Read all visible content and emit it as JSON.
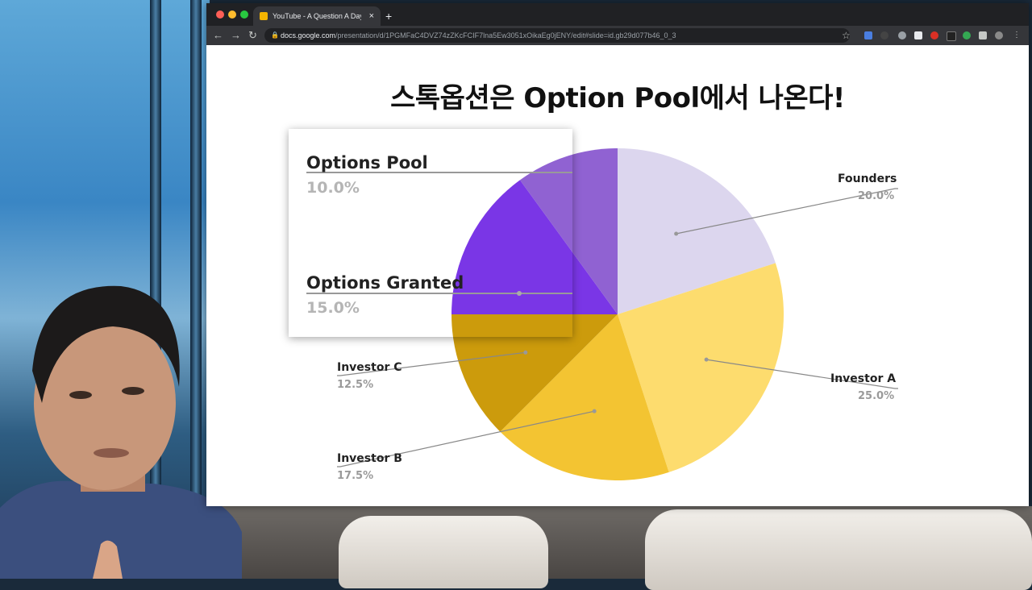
{
  "browser": {
    "tab_title": "YouTube - A Question A Day 1",
    "tab_close": "×",
    "new_tab": "+",
    "url_host": "docs.google.com",
    "url_path": "/presentation/d/1PGMFaC4DVZ74zZKcFCIF7lna5Ew3051xOikaEg0jENY/edit#slide=id.gb29d077b46_0_3",
    "back": "←",
    "forward": "→",
    "reload": "↻",
    "bookmark": "☆",
    "traffic_colors": [
      "#ff5f57",
      "#febc2e",
      "#28c840"
    ]
  },
  "slide": {
    "title": "스톡옵션은 Option Pool에서 나온다!"
  },
  "chart_data": {
    "type": "pie",
    "slices": [
      {
        "label": "Founders",
        "percent": "20.0%",
        "value": 20.0,
        "color": "#dcd6ee"
      },
      {
        "label": "Investor A",
        "percent": "25.0%",
        "value": 25.0,
        "color": "#fddc6e"
      },
      {
        "label": "Investor B",
        "percent": "17.5%",
        "value": 17.5,
        "color": "#f3c432"
      },
      {
        "label": "Investor C",
        "percent": "12.5%",
        "value": 12.5,
        "color": "#cc9b0c"
      },
      {
        "label": "Options Granted",
        "percent": "15.0%",
        "value": 15.0,
        "color": "#7a36e6"
      },
      {
        "label": "Options Pool",
        "percent": "10.0%",
        "value": 10.0,
        "color": "#9062d2"
      }
    ]
  }
}
